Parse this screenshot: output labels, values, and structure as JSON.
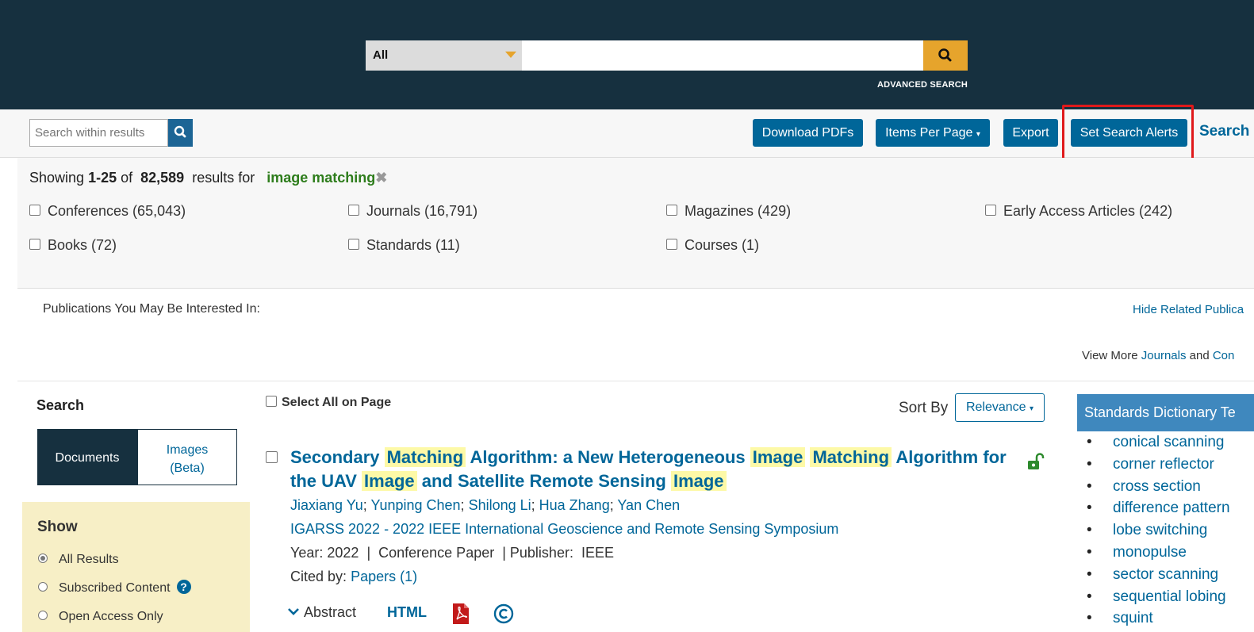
{
  "header": {
    "scope_label": "All",
    "search_value": "",
    "advanced_search": "ADVANCED SEARCH"
  },
  "toolbar": {
    "within_placeholder": "Search within results",
    "download_pdfs": "Download PDFs",
    "items_per_page": "Items Per Page",
    "export": "Export",
    "set_alerts": "Set Search Alerts",
    "search_tips": "Search"
  },
  "results_summary": {
    "showing": "Showing",
    "range": "1-25",
    "of": "of",
    "total": "82,589",
    "results_for": "results for",
    "query": "image matching"
  },
  "facets": [
    {
      "label": "Conferences (65,043)"
    },
    {
      "label": "Journals (16,791)"
    },
    {
      "label": "Magazines (429)"
    },
    {
      "label": "Early Access Articles (242)"
    },
    {
      "label": "Books (72)"
    },
    {
      "label": "Standards (11)"
    },
    {
      "label": "Courses (1)"
    }
  ],
  "publications": {
    "label": "Publications You May Be Interested In:",
    "hide": "Hide Related Publica",
    "view_more": "View More",
    "journals": "Journals",
    "and": "and",
    "conferences": "Con"
  },
  "left": {
    "search_title": "Search",
    "tab_documents": "Documents",
    "tab_images": "Images (Beta)",
    "show_title": "Show",
    "radios": [
      {
        "label": "All Results",
        "selected": true
      },
      {
        "label": "Subscribed Content",
        "selected": false
      },
      {
        "label": "Open Access Only",
        "selected": false
      }
    ],
    "help_glyph": "?"
  },
  "results": {
    "select_all": "Select All on Page",
    "sort_by": "Sort By",
    "sort_value": "Relevance",
    "items": [
      {
        "title_parts": [
          {
            "t": "Secondary ",
            "hl": false
          },
          {
            "t": "Matching",
            "hl": true
          },
          {
            "t": " Algorithm: a New Heterogeneous ",
            "hl": false
          },
          {
            "t": "Image",
            "hl": true
          },
          {
            "t": " ",
            "hl": false
          },
          {
            "t": "Matching",
            "hl": true
          },
          {
            "t": " Algorithm for the UAV ",
            "hl": false
          },
          {
            "t": "Image",
            "hl": true
          },
          {
            "t": " and Satellite Remote Sensing ",
            "hl": false
          },
          {
            "t": "Image",
            "hl": true
          }
        ],
        "authors": [
          "Jiaxiang Yu",
          "Yunping Chen",
          "Shilong Li",
          "Hua Zhang",
          "Yan Chen"
        ],
        "venue": "IGARSS 2022 - 2022 IEEE International Geoscience and Remote Sensing Symposium",
        "year_label": "Year:",
        "year": "2022",
        "type": "Conference Paper",
        "publisher_label": "Publisher:",
        "publisher": "IEEE",
        "cited_label": "Cited by:",
        "cited_link": "Papers (1)",
        "abstract": "Abstract",
        "html": "HTML"
      }
    ]
  },
  "standards": {
    "heading": "Standards Dictionary Te",
    "terms": [
      "conical scanning",
      "corner reflector",
      "cross section",
      "difference pattern",
      "lobe switching",
      "monopulse",
      "sector scanning",
      "sequential lobing",
      "squint"
    ]
  },
  "colors": {
    "header_bg": "#16303f",
    "accent": "#e6a42c",
    "button": "#006699",
    "highlight_box": "#e0191b",
    "query_green": "#2e7d1c"
  }
}
